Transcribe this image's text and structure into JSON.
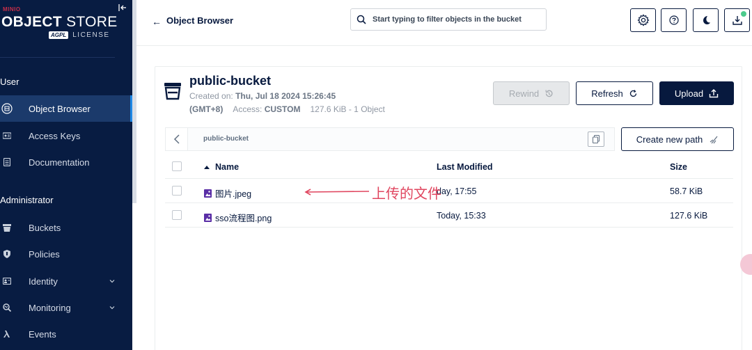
{
  "sidebar": {
    "logo_small": "MINIO",
    "logo_title_bold": "OBJECT",
    "logo_title_rest": " STORE",
    "badge": "AGPL",
    "license": "LICENSE",
    "sections": {
      "user": "User",
      "admin": "Administrator"
    },
    "items": [
      {
        "label": "Object Browser",
        "icon": "object-browser-icon"
      },
      {
        "label": "Access Keys",
        "icon": "key-icon"
      },
      {
        "label": "Documentation",
        "icon": "doc-icon"
      },
      {
        "label": "Buckets",
        "icon": "bucket-icon"
      },
      {
        "label": "Policies",
        "icon": "shield-icon"
      },
      {
        "label": "Identity",
        "icon": "identity-icon"
      },
      {
        "label": "Monitoring",
        "icon": "monitoring-icon"
      },
      {
        "label": "Events",
        "icon": "lambda-icon"
      }
    ]
  },
  "header": {
    "title": "Object Browser",
    "search_placeholder": "Start typing to filter objects in the bucket"
  },
  "bucket": {
    "name": "public-bucket",
    "created_label": "Created on:",
    "created_value": "Thu, Jul 18 2024 15:26:45",
    "timezone": "(GMT+8)",
    "access_label": "Access:",
    "access_value": "CUSTOM",
    "usage": "127.6 KiB - 1 Object"
  },
  "actions": {
    "rewind": "Rewind",
    "refresh": "Refresh",
    "upload": "Upload",
    "create_path": "Create new path"
  },
  "path": {
    "current": "public-bucket"
  },
  "table": {
    "headers": {
      "name": "Name",
      "modified": "Last Modified",
      "size": "Size"
    },
    "rows": [
      {
        "name": "图片.jpeg",
        "modified": "day, 17:55",
        "size": "58.7 KiB"
      },
      {
        "name": "sso流程图.png",
        "modified": "Today, 15:33",
        "size": "127.6 KiB"
      }
    ]
  },
  "annotation": {
    "text": "上传的文件"
  },
  "colors": {
    "sidebar": "#081c42",
    "accent": "#07193e",
    "annotation": "#e0465f",
    "online_dot": "#4ccb8d"
  }
}
